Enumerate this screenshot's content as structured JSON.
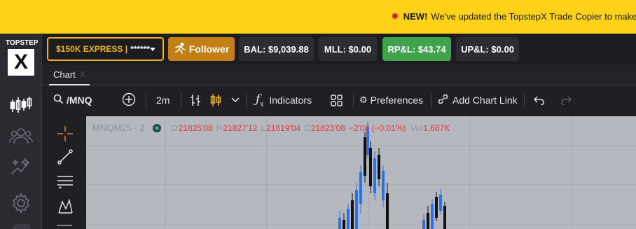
{
  "banner": {
    "new_label": "NEW!",
    "message": "We've updated the TopstepX Trade Copier to make",
    "spark_icon": "burst-icon"
  },
  "logo": {
    "top_text": "TOPSTEP",
    "letter": "X"
  },
  "sidebar": {
    "items": [
      {
        "name": "chart-candles-icon",
        "active": true
      },
      {
        "name": "users-icon",
        "active": false
      },
      {
        "name": "sparkles-icon",
        "active": false
      },
      {
        "name": "gear-icon",
        "active": false
      }
    ]
  },
  "topbar": {
    "account_label": "$150K EXPRESS |",
    "account_mask": "******",
    "follower_label": "Follower",
    "balance": "BAL: $9,039.88",
    "mll": "MLL: $0.00",
    "rpl": "RP&L: $43.74",
    "upl": "UP&L: $0.00",
    "colors": {
      "account": "#f1b51c",
      "follower": "#c17f16",
      "rpl": "#3fa34d"
    }
  },
  "tabs": [
    {
      "label": "Chart",
      "close": "X"
    }
  ],
  "toolbar": {
    "symbol": "/MNQ",
    "interval": "2m",
    "indicators_label": "Indicators",
    "preferences_label": "Preferences",
    "add_chart_link_label": "Add Chart Link"
  },
  "chart": {
    "symbol_label": "MNQM25 · 2",
    "o_key": "O",
    "o_val": "21825'08",
    "h_key": "H",
    "h_val": "21827'12",
    "l_key": "L",
    "l_val": "21819'04",
    "c_key": "C",
    "c_val": "21823'08",
    "change": "−2'08 (−0.01%)",
    "vol_key": "Vol",
    "vol_val": "1.687K"
  },
  "chart_data": {
    "type": "candlestick",
    "title": "",
    "ohlc_legend": {
      "open": "21825'08",
      "high": "21827'12",
      "low": "21819'04",
      "close": "21823'08",
      "volume": "1.687K"
    },
    "up_color": "#2f6fe0",
    "down_color": "#111111"
  }
}
